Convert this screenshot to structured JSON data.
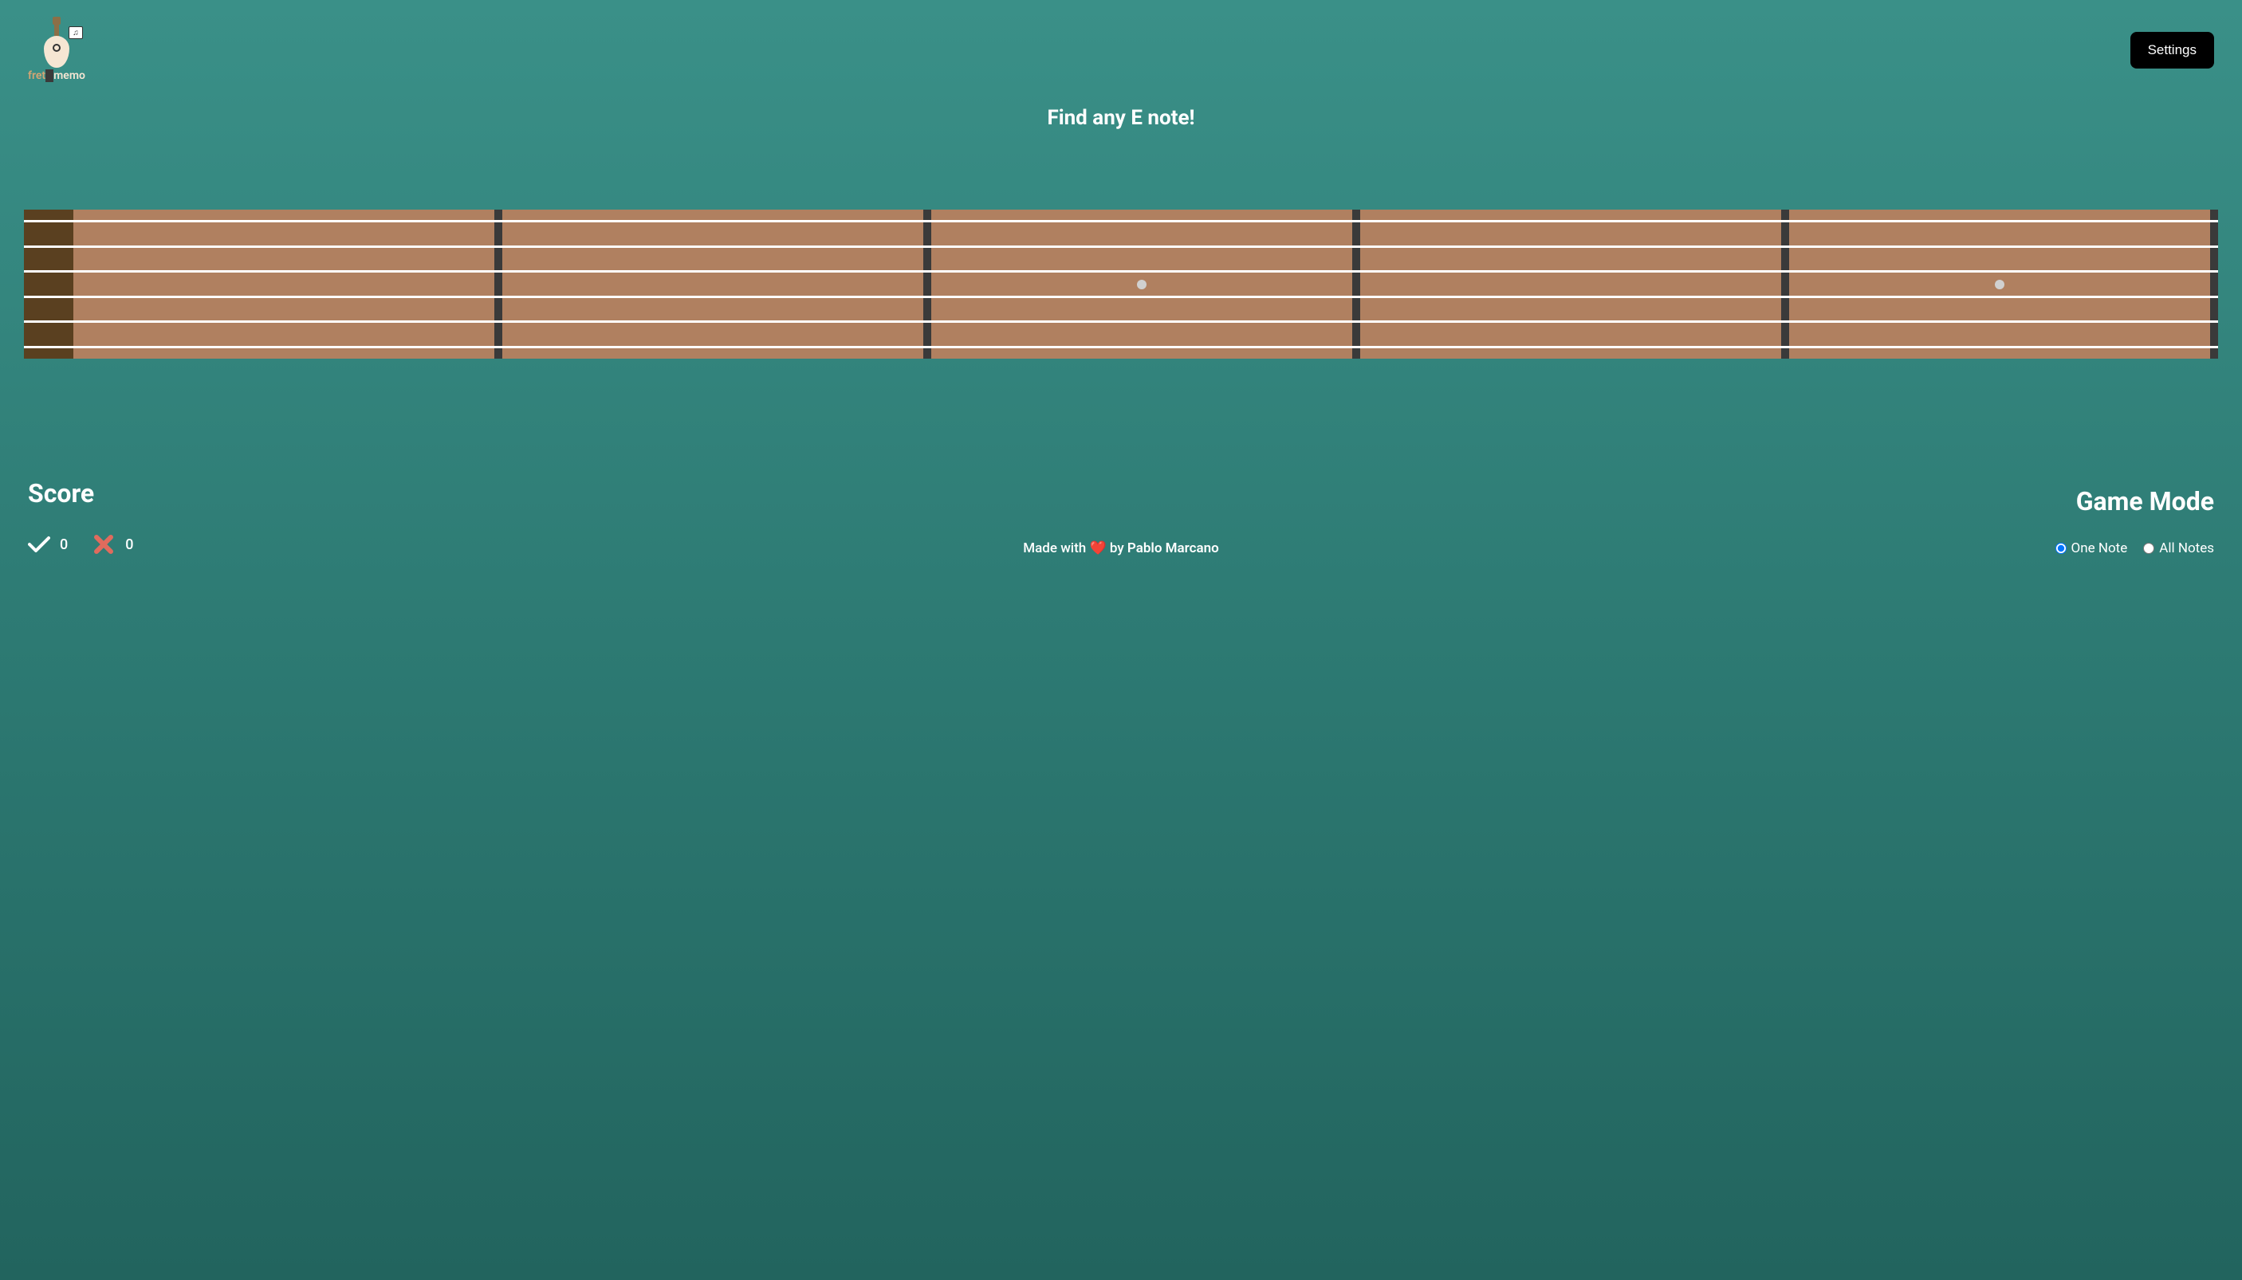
{
  "header": {
    "logo": {
      "text_part1": "fret",
      "text_part2": "memo"
    },
    "settings_label": "Settings"
  },
  "prompt": "Find any E note!",
  "fretboard": {
    "num_frets": 5,
    "num_strings": 6,
    "markers": [
      3,
      5
    ]
  },
  "score": {
    "heading": "Score",
    "correct": "0",
    "incorrect": "0"
  },
  "footer": {
    "prefix": "Made with ❤️ by ",
    "author": "Pablo Marcano"
  },
  "game_mode": {
    "heading": "Game Mode",
    "options": [
      {
        "label": "One Note",
        "checked": true
      },
      {
        "label": "All Notes",
        "checked": false
      }
    ]
  }
}
